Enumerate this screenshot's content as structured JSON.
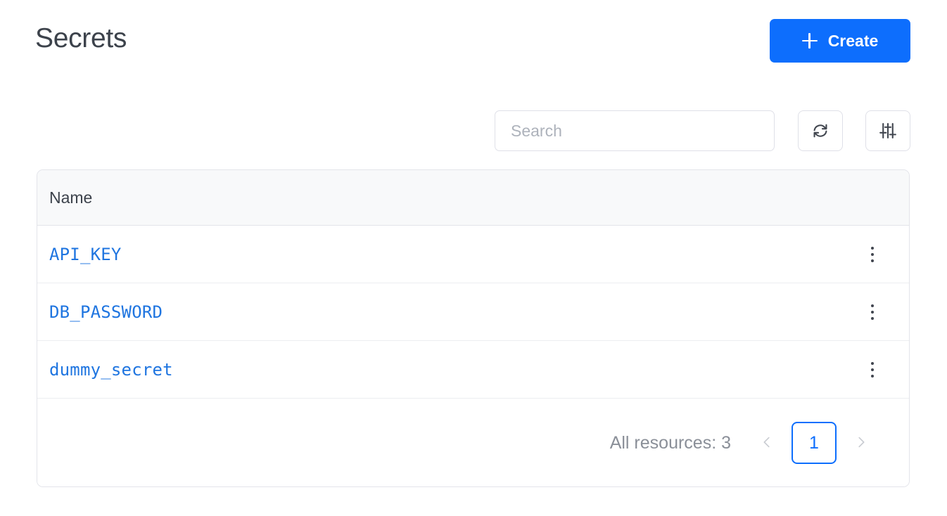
{
  "header": {
    "title": "Secrets",
    "create_button": {
      "label": "Create",
      "icon": "plus-icon",
      "color": "#0d6efd"
    }
  },
  "toolbar": {
    "search": {
      "placeholder": "Search",
      "value": ""
    },
    "refresh_button": {
      "icon": "refresh-icon",
      "label": ""
    },
    "filter_button": {
      "icon": "sliders-icon",
      "label": ""
    }
  },
  "table": {
    "columns": [
      "Name"
    ],
    "rows": [
      {
        "name": "API_KEY",
        "menu_icon": "kebab-menu-icon"
      },
      {
        "name": "DB_PASSWORD",
        "menu_icon": "kebab-menu-icon"
      },
      {
        "name": "dummy_secret",
        "menu_icon": "kebab-menu-icon"
      }
    ],
    "row_name_color": "#1f75e0"
  },
  "pagination": {
    "resources_label": "All resources: 3",
    "prev_label": "‹",
    "next_label": "›",
    "current_page": "1",
    "accent_color": "#0d6efd"
  }
}
